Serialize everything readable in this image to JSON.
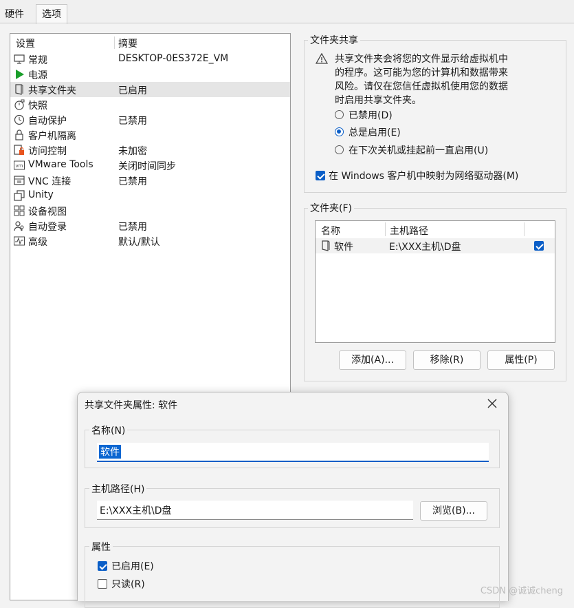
{
  "tabs": [
    {
      "label": "硬件"
    },
    {
      "label": "选项"
    }
  ],
  "settings": {
    "col_setting": "设置",
    "col_summary": "摘要",
    "rows": [
      {
        "name": "常规",
        "summary": "DESKTOP-0ES372E_VM",
        "icon": "monitor-icon"
      },
      {
        "name": "电源",
        "summary": "",
        "icon": "play-icon"
      },
      {
        "name": "共享文件夹",
        "summary": "已启用",
        "icon": "shared-folder-icon"
      },
      {
        "name": "快照",
        "summary": "",
        "icon": "snapshot-icon"
      },
      {
        "name": "自动保护",
        "summary": "已禁用",
        "icon": "clock-icon"
      },
      {
        "name": "客户机隔离",
        "summary": "",
        "icon": "lock-icon"
      },
      {
        "name": "访问控制",
        "summary": "未加密",
        "icon": "access-control-icon"
      },
      {
        "name": "VMware Tools",
        "summary": "关闭时间同步",
        "icon": "vm-icon"
      },
      {
        "name": "VNC 连接",
        "summary": "已禁用",
        "icon": "vnc-icon"
      },
      {
        "name": "Unity",
        "summary": "",
        "icon": "unity-icon"
      },
      {
        "name": "设备视图",
        "summary": "",
        "icon": "device-view-icon"
      },
      {
        "name": "自动登录",
        "summary": "已禁用",
        "icon": "user-key-icon"
      },
      {
        "name": "高级",
        "summary": "默认/默认",
        "icon": "pulse-icon"
      }
    ]
  },
  "sharing": {
    "title": "文件夹共享",
    "warning_lines": [
      "共享文件夹会将您的文件显示给虚拟机中",
      "的程序。这可能为您的计算机和数据带来",
      "风险。请仅在您信任虚拟机使用您的数据",
      "时启用共享文件夹。"
    ],
    "options": [
      {
        "label": "已禁用(D)",
        "selected": false
      },
      {
        "label": "总是启用(E)",
        "selected": true
      },
      {
        "label": "在下次关机或挂起前一直启用(U)",
        "selected": false
      }
    ],
    "map_drive_label": "在 Windows 客户机中映射为网络驱动器(M)",
    "map_drive_checked": true
  },
  "folders": {
    "title": "文件夹(F)",
    "col_name": "名称",
    "col_path": "主机路径",
    "items": [
      {
        "name": "软件",
        "path": "E:\\XXX主机\\D盘",
        "enabled": true
      }
    ],
    "buttons": {
      "add": "添加(A)...",
      "remove": "移除(R)",
      "properties": "属性(P)"
    }
  },
  "dialog": {
    "title": "共享文件夹属性: 软件",
    "name_group": "名称(N)",
    "name_value": "软件",
    "path_group": "主机路径(H)",
    "path_value": "E:\\XXX主机\\D盘",
    "browse": "浏览(B)...",
    "attr_group": "属性",
    "enabled_label": "已启用(E)",
    "enabled_checked": true,
    "readonly_label": "只读(R)",
    "readonly_checked": false
  },
  "watermark": "CSDN @诚诚cheng",
  "colors": {
    "accent": "#0a5ec7",
    "selection": "#e5e5e5",
    "green_play": "#1a9e2a"
  }
}
